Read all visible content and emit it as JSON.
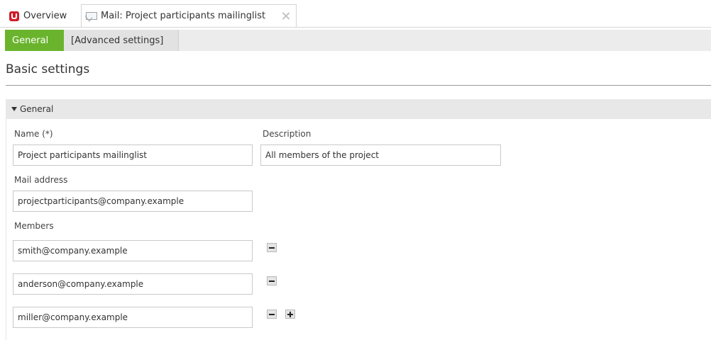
{
  "tabs": [
    {
      "label": "Overview",
      "icon": "app-logo-icon"
    },
    {
      "label": "Mail: Project participants mailinglist",
      "icon": "mail-icon"
    }
  ],
  "sub_tabs": [
    {
      "label": "General",
      "active": true
    },
    {
      "label": "[Advanced settings]",
      "active": false
    }
  ],
  "page_title": "Basic settings",
  "section": {
    "title": "General",
    "expanded": true
  },
  "form": {
    "name_label": "Name (*)",
    "name_value": "Project participants mailinglist",
    "description_label": "Description",
    "description_value": "All members of the project",
    "mail_label": "Mail address",
    "mail_value": "projectparticipants@company.example",
    "members_label": "Members",
    "members": [
      "smith@company.example",
      "anderson@company.example",
      "miller@company.example"
    ]
  },
  "colors": {
    "accent": "#6ab42d",
    "logo": "#cf1f2a"
  }
}
